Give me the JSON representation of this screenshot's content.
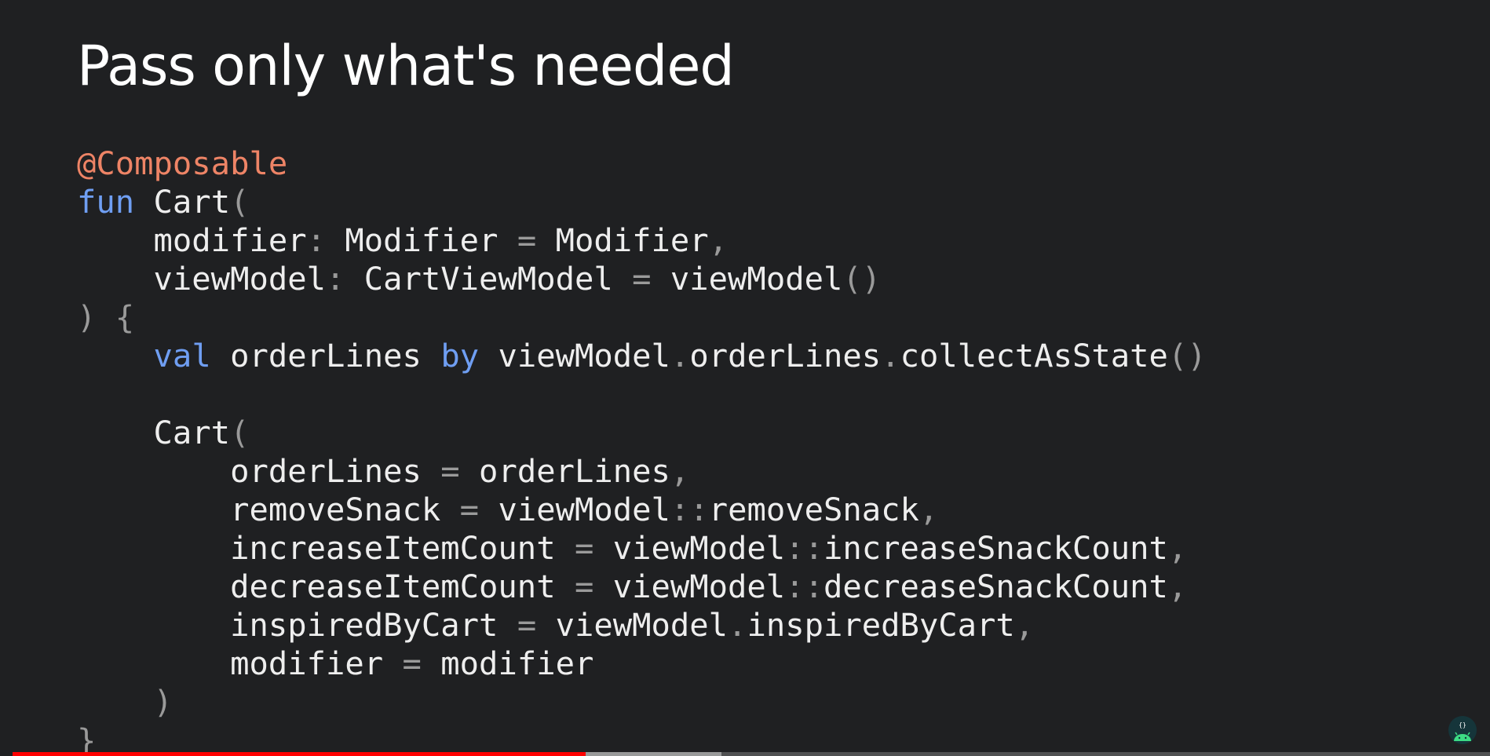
{
  "slide": {
    "title": "Pass only what's needed"
  },
  "code": {
    "lines": [
      [
        {
          "t": "@Composable",
          "k": "annotation"
        }
      ],
      [
        {
          "t": "fun",
          "k": "keyword"
        },
        {
          "t": " Cart",
          "k": "plain"
        },
        {
          "t": "(",
          "k": "punct"
        }
      ],
      [
        {
          "t": "    modifier",
          "k": "plain"
        },
        {
          "t": ":",
          "k": "punct"
        },
        {
          "t": " Modifier ",
          "k": "plain"
        },
        {
          "t": "=",
          "k": "punct"
        },
        {
          "t": " Modifier",
          "k": "plain"
        },
        {
          "t": ",",
          "k": "punct"
        }
      ],
      [
        {
          "t": "    viewModel",
          "k": "plain"
        },
        {
          "t": ":",
          "k": "punct"
        },
        {
          "t": " CartViewModel ",
          "k": "plain"
        },
        {
          "t": "=",
          "k": "punct"
        },
        {
          "t": " viewModel",
          "k": "plain"
        },
        {
          "t": "()",
          "k": "punct"
        }
      ],
      [
        {
          "t": ") {",
          "k": "punct"
        }
      ],
      [
        {
          "t": "    ",
          "k": "plain"
        },
        {
          "t": "val",
          "k": "keyword"
        },
        {
          "t": " orderLines ",
          "k": "plain"
        },
        {
          "t": "by",
          "k": "keyword"
        },
        {
          "t": " viewModel",
          "k": "plain"
        },
        {
          "t": ".",
          "k": "punct"
        },
        {
          "t": "orderLines",
          "k": "plain"
        },
        {
          "t": ".",
          "k": "punct"
        },
        {
          "t": "collectAsState",
          "k": "plain"
        },
        {
          "t": "()",
          "k": "punct"
        }
      ],
      [],
      [
        {
          "t": "    Cart",
          "k": "plain"
        },
        {
          "t": "(",
          "k": "punct"
        }
      ],
      [
        {
          "t": "        orderLines ",
          "k": "plain"
        },
        {
          "t": "=",
          "k": "punct"
        },
        {
          "t": " orderLines",
          "k": "plain"
        },
        {
          "t": ",",
          "k": "punct"
        }
      ],
      [
        {
          "t": "        removeSnack ",
          "k": "plain"
        },
        {
          "t": "=",
          "k": "punct"
        },
        {
          "t": " viewModel",
          "k": "plain"
        },
        {
          "t": "::",
          "k": "punct"
        },
        {
          "t": "removeSnack",
          "k": "plain"
        },
        {
          "t": ",",
          "k": "punct"
        }
      ],
      [
        {
          "t": "        increaseItemCount ",
          "k": "plain"
        },
        {
          "t": "=",
          "k": "punct"
        },
        {
          "t": " viewModel",
          "k": "plain"
        },
        {
          "t": "::",
          "k": "punct"
        },
        {
          "t": "increaseSnackCount",
          "k": "plain"
        },
        {
          "t": ",",
          "k": "punct"
        }
      ],
      [
        {
          "t": "        decreaseItemCount ",
          "k": "plain"
        },
        {
          "t": "=",
          "k": "punct"
        },
        {
          "t": " viewModel",
          "k": "plain"
        },
        {
          "t": "::",
          "k": "punct"
        },
        {
          "t": "decreaseSnackCount",
          "k": "plain"
        },
        {
          "t": ",",
          "k": "punct"
        }
      ],
      [
        {
          "t": "        inspiredByCart ",
          "k": "plain"
        },
        {
          "t": "=",
          "k": "punct"
        },
        {
          "t": " viewModel",
          "k": "plain"
        },
        {
          "t": ".",
          "k": "punct"
        },
        {
          "t": "inspiredByCart",
          "k": "plain"
        },
        {
          "t": ",",
          "k": "punct"
        }
      ],
      [
        {
          "t": "        modifier ",
          "k": "plain"
        },
        {
          "t": "=",
          "k": "punct"
        },
        {
          "t": " modifier",
          "k": "plain"
        }
      ],
      [
        {
          "t": "    )",
          "k": "punct"
        }
      ],
      [
        {
          "t": "}",
          "k": "punct"
        }
      ]
    ]
  },
  "colors": {
    "background": "#1f2022",
    "title": "#ffffff",
    "annotation": "#ee8466",
    "keyword": "#6f9ef2",
    "punctuation": "#9a9a9a",
    "identifier": "#eeeeee",
    "progress_played": "#ff0000"
  },
  "player": {
    "progress_played_fraction": 0.388,
    "progress_buffered_fraction": 0.48
  },
  "badge": {
    "icon": "android-code-icon"
  }
}
